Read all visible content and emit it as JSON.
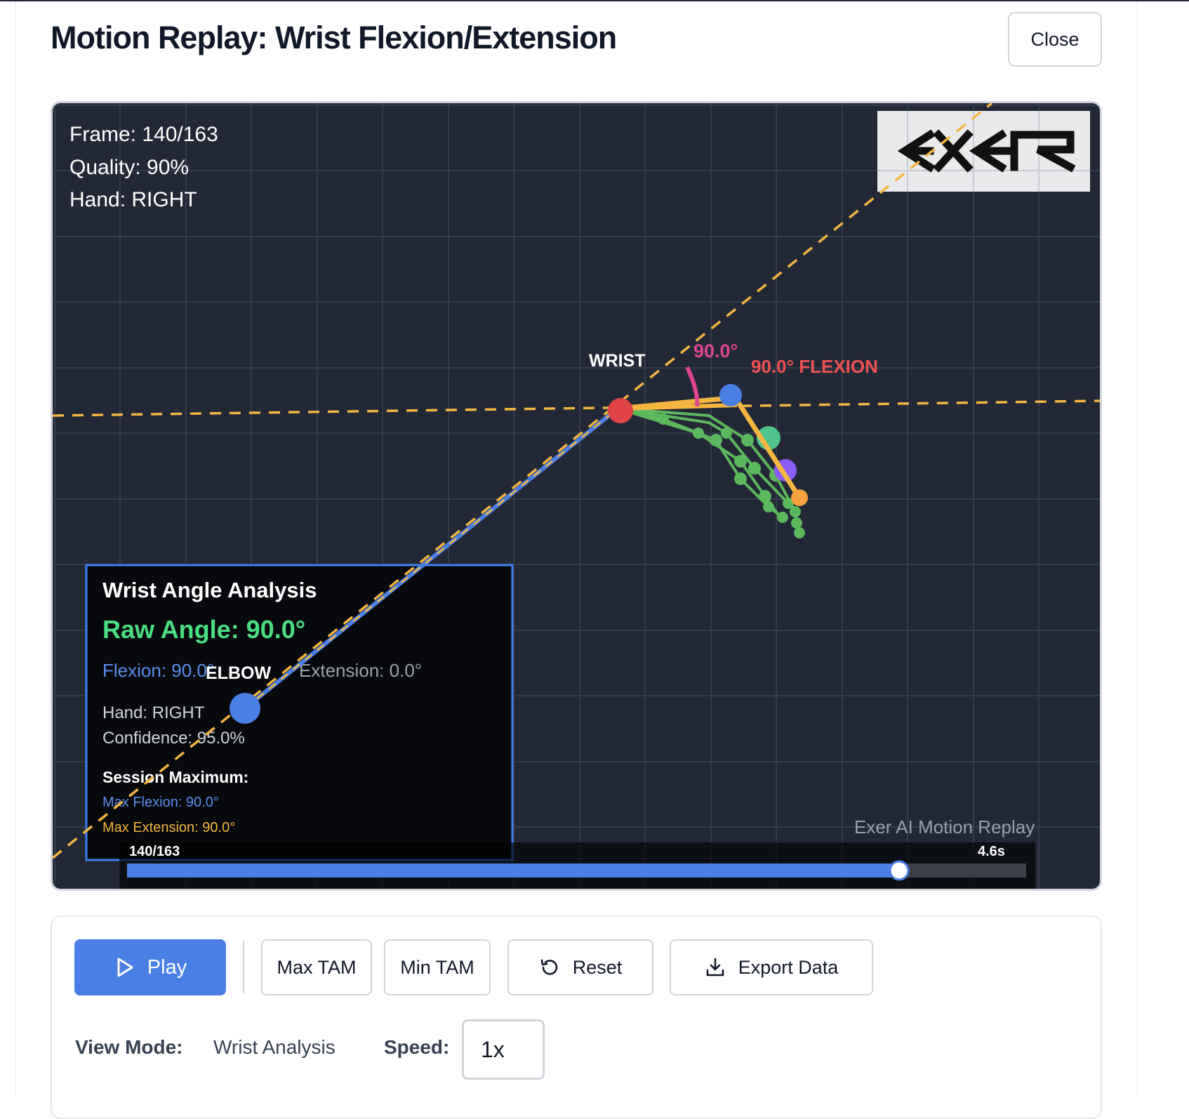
{
  "modal": {
    "title": "Motion Replay: Wrist Flexion/Extension",
    "close_label": "Close"
  },
  "viewer": {
    "frame_text": "Frame: 140/163",
    "quality_text": "Quality: 90%",
    "hand_text": "Hand: RIGHT",
    "logo_text": "EXER",
    "labels": {
      "wrist": "WRIST",
      "elbow": "ELBOW",
      "angle_arc": "90.0°",
      "flexion_callout": "90.0° FLEXION"
    },
    "analysis": {
      "title": "Wrist Angle Analysis",
      "raw_angle": "Raw Angle: 90.0°",
      "flexion": "Flexion: 90.0°",
      "extension": "Extension: 0.0°",
      "hand": "Hand: RIGHT",
      "confidence": "Confidence: 95.0%",
      "session_title": "Session Maximum:",
      "max_flexion": "Max Flexion: 90.0°",
      "max_extension": "Max Extension: 90.0°"
    },
    "watermark": "Exer AI Motion Replay",
    "timeline": {
      "frame_label": "140/163",
      "time_label": "4.6s",
      "current_frame": 140,
      "total_frames": 163
    },
    "colors": {
      "background": "#222836",
      "grid": "#343b4b",
      "guide_line": "#f4b63f",
      "forearm": "#4a7fe6",
      "wrist_joint": "#e04343",
      "fingers": "#5cb85c",
      "thumb": "#f4b63f",
      "arc": "#e0458f",
      "panel_border": "#3b82f6",
      "raw_angle": "#4ade80",
      "flexion_text": "#5b8def",
      "callout": "#f05252"
    }
  },
  "controls": {
    "play_label": "Play",
    "max_tam_label": "Max TAM",
    "min_tam_label": "Min TAM",
    "reset_label": "Reset",
    "export_label": "Export Data",
    "view_mode_label": "View Mode:",
    "view_mode_value": "Wrist Analysis",
    "speed_label": "Speed:",
    "speed_value": "1x",
    "icons": {
      "play": "play-icon",
      "reset": "reset-icon",
      "export": "download-icon"
    }
  }
}
